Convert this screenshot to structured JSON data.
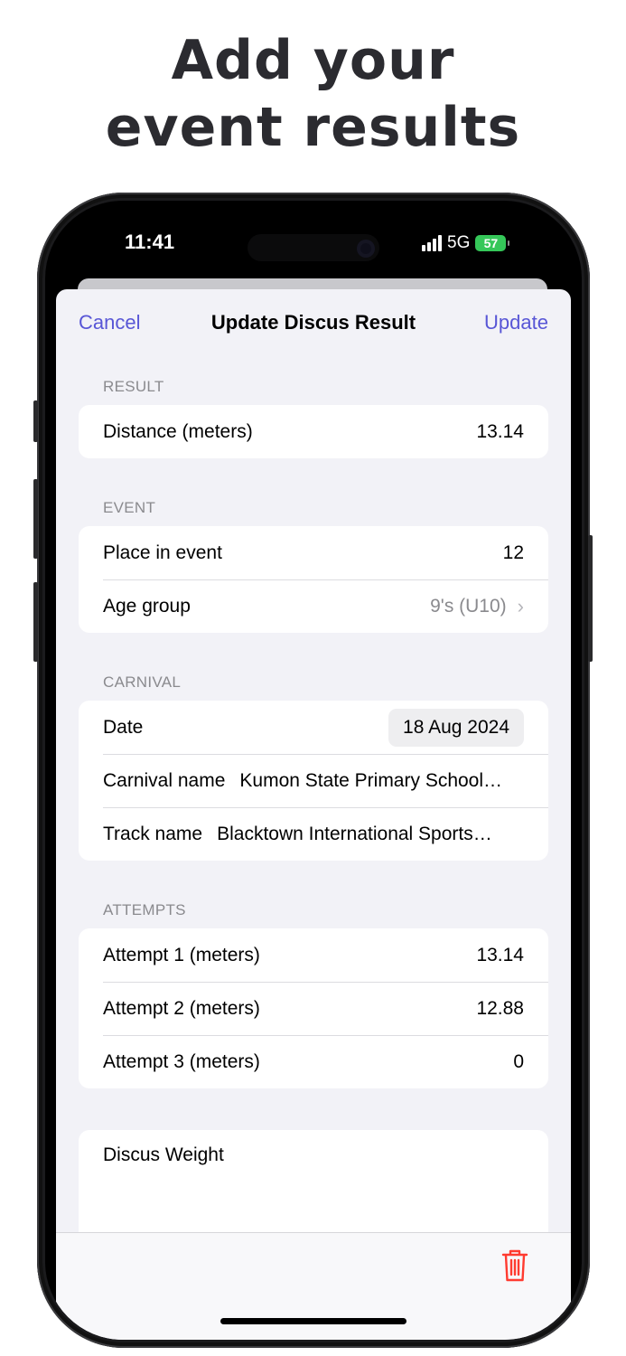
{
  "headline": {
    "line1": "Add your",
    "line2": "event results"
  },
  "status_bar": {
    "time": "11:41",
    "network": "5G",
    "battery": "57"
  },
  "nav": {
    "cancel": "Cancel",
    "title": "Update Discus Result",
    "update": "Update"
  },
  "sections": {
    "result": {
      "header": "RESULT",
      "rows": [
        {
          "label": "Distance (meters)",
          "value": "13.14"
        }
      ]
    },
    "event": {
      "header": "EVENT",
      "rows": [
        {
          "label": "Place in event",
          "value": "12"
        },
        {
          "label": "Age group",
          "value": "9's (U10)"
        }
      ]
    },
    "carnival": {
      "header": "CARNIVAL",
      "rows": [
        {
          "label": "Date",
          "value": "18 Aug 2024"
        },
        {
          "label": "Carnival name",
          "value": "Kumon State Primary School…"
        },
        {
          "label": "Track name",
          "value": "Blacktown International Sports…"
        }
      ]
    },
    "attempts": {
      "header": "ATTEMPTS",
      "rows": [
        {
          "label": "Attempt 1 (meters)",
          "value": "13.14"
        },
        {
          "label": "Attempt 2 (meters)",
          "value": "12.88"
        },
        {
          "label": "Attempt 3 (meters)",
          "value": "0"
        }
      ]
    },
    "notes": {
      "label": "Discus Weight"
    }
  },
  "colors": {
    "accent": "#5856d6",
    "destructive": "#ff3b30",
    "background": "#f2f2f7"
  },
  "icons": {
    "delete": "trash-icon",
    "disclosure": "chevron-right-icon"
  }
}
